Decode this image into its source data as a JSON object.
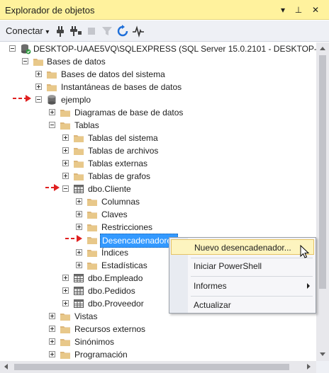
{
  "window": {
    "title": "Explorador de objetos"
  },
  "titlebar_buttons": {
    "dropdown": "▾",
    "pin": "⊥",
    "close": "✕"
  },
  "toolbar": {
    "connect_label": "Conectar",
    "connect_caret": "▾",
    "icons": [
      "plug-icon",
      "disconnect-icon",
      "stop-icon",
      "filter-icon",
      "refresh-icon",
      "activity-monitor-icon"
    ]
  },
  "tree": {
    "server": "DESKTOP-UAAE5VQ\\SQLEXPRESS (SQL Server 15.0.2101 - DESKTOP-UAAE5V",
    "databases": "Bases de datos",
    "system_databases": "Bases de datos del sistema",
    "snapshots": "Instantáneas de bases de datos",
    "db_ejemplo": "ejemplo",
    "diagrams": "Diagramas de base de datos",
    "tables": "Tablas",
    "system_tables": "Tablas del sistema",
    "file_tables": "Tablas de archivos",
    "external_tables": "Tablas externas",
    "graph_tables": "Tablas de grafos",
    "dbo_cliente": "dbo.Cliente",
    "columns": "Columnas",
    "keys": "Claves",
    "constraints": "Restricciones",
    "triggers": "Desencadenadores",
    "indexes": "Índices",
    "statistics": "Estadísticas",
    "dbo_empleado": "dbo.Empleado",
    "dbo_pedidos": "dbo.Pedidos",
    "dbo_proveedor": "dbo.Proveedor",
    "views": "Vistas",
    "external_resources": "Recursos externos",
    "synonyms": "Sinónimos",
    "programming": "Programación"
  },
  "context_menu": {
    "new_trigger": "Nuevo desencadenador...",
    "powershell": "Iniciar PowerShell",
    "reports": "Informes",
    "refresh": "Actualizar"
  },
  "colors": {
    "title_bg": "#fff29d",
    "selection": "#3399ff",
    "annotation_arrow": "#e02020",
    "folder": "#dcb67a"
  }
}
